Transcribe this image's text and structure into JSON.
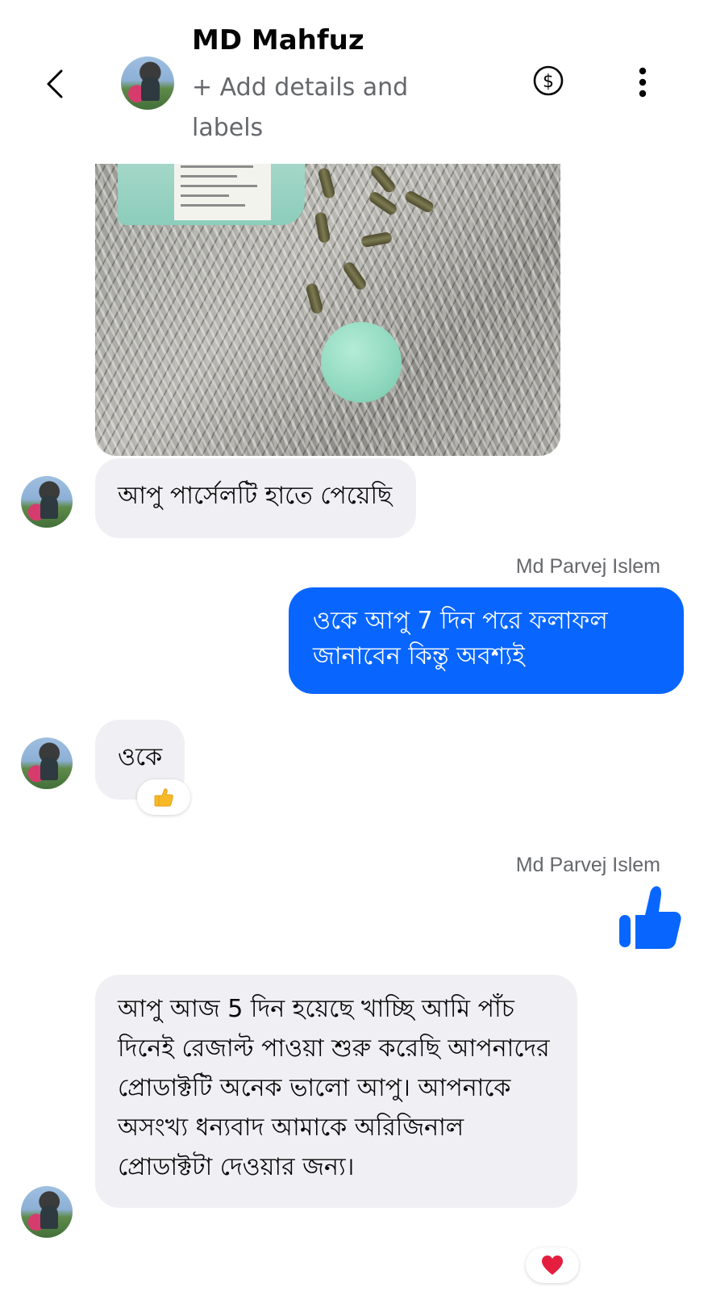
{
  "header": {
    "name": "MD Mahfuz",
    "details_label": "+ Add details and labels"
  },
  "messages": [
    {
      "from": "contact",
      "text": "আপু পার্সেলটি হাতে পেয়েছি"
    },
    {
      "from": "me",
      "sender": "Md Parvej Islem",
      "text": "ওকে আপু 7 দিন পরে ফলাফল জানাবেন কিন্তু অবশ্যই"
    },
    {
      "from": "contact",
      "text": "ওকে",
      "reaction": "thumbs-up"
    },
    {
      "from": "me",
      "sender": "Md Parvej Islem",
      "sticker": "thumbs-up"
    },
    {
      "from": "contact",
      "text": "আপু আজ 5 দিন হয়েছে খাচ্ছি আমি পাঁচ দিনেই রেজাল্ট পাওয়া শুরু করেছি আপনাদের প্রোডাক্টটি অনেক ভালো আপু। আপনাকে অসংখ্য ধন্যবাদ আমাকে অরিজিনাল প্রোডাক্টটা দেওয়ার জন্য।",
      "reaction": "heart"
    }
  ],
  "colors": {
    "outgoing_bubble": "#0866ff",
    "incoming_bubble": "#f0f0f4",
    "secondary_text": "#65676b"
  }
}
